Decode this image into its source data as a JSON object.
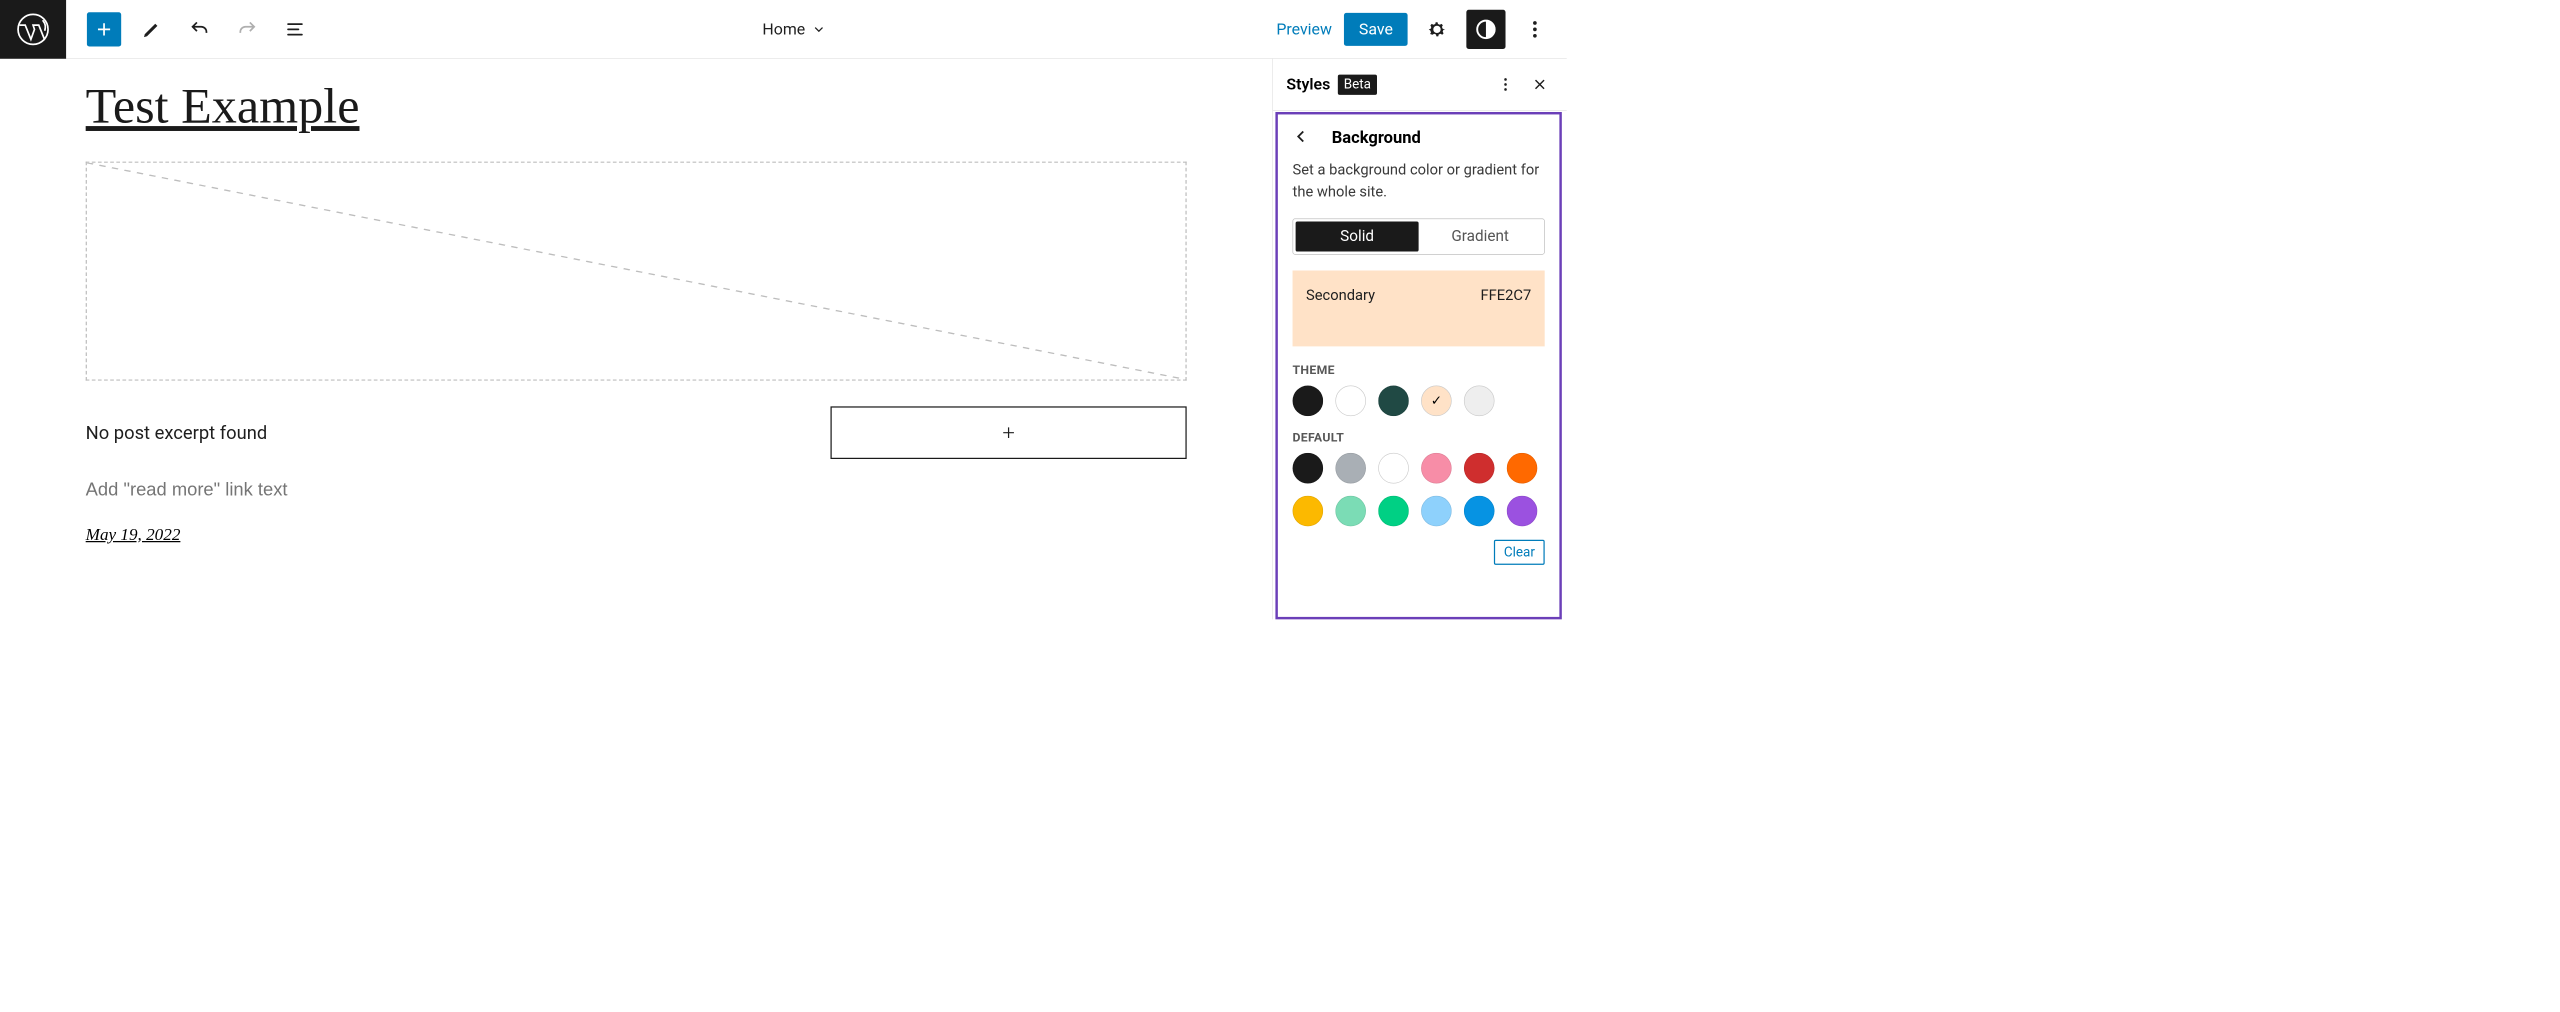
{
  "toolbar": {
    "document_label": "Home",
    "preview_label": "Preview",
    "save_label": "Save"
  },
  "canvas": {
    "site_title": "Test Example",
    "excerpt_text": "No post excerpt found",
    "readmore_placeholder": "Add \"read more\" link text",
    "post_date": "May 19, 2022"
  },
  "sidebar": {
    "title": "Styles",
    "badge": "Beta",
    "panel": {
      "title": "Background",
      "description": "Set a background color or gradient for the whole site.",
      "tabs": {
        "solid": "Solid",
        "gradient": "Gradient",
        "active": "solid"
      },
      "current": {
        "name": "Secondary",
        "hex": "FFE2C7",
        "swatch": "#FFE2C7"
      },
      "groups": [
        {
          "label": "THEME",
          "swatches": [
            {
              "name": "black",
              "hex": "#1a1a1a",
              "light": false,
              "selected": false
            },
            {
              "name": "white",
              "hex": "#ffffff",
              "light": true,
              "selected": false
            },
            {
              "name": "teal-dark",
              "hex": "#204944",
              "light": false,
              "selected": false
            },
            {
              "name": "secondary",
              "hex": "#ffe2c7",
              "light": true,
              "selected": true
            },
            {
              "name": "grey-200",
              "hex": "#eeeeee",
              "light": true,
              "selected": false
            }
          ]
        },
        {
          "label": "DEFAULT",
          "swatches": [
            {
              "name": "black",
              "hex": "#1a1a1a",
              "light": false,
              "selected": false
            },
            {
              "name": "grey",
              "hex": "#a9afb5",
              "light": false,
              "selected": false
            },
            {
              "name": "white",
              "hex": "#ffffff",
              "light": true,
              "selected": false
            },
            {
              "name": "pink",
              "hex": "#f78da7",
              "light": false,
              "selected": false
            },
            {
              "name": "red",
              "hex": "#cf2e2e",
              "light": false,
              "selected": false
            },
            {
              "name": "orange",
              "hex": "#ff6900",
              "light": false,
              "selected": false
            },
            {
              "name": "amber",
              "hex": "#fcb900",
              "light": false,
              "selected": false
            },
            {
              "name": "green-light",
              "hex": "#7bdcb5",
              "light": false,
              "selected": false
            },
            {
              "name": "green",
              "hex": "#00d084",
              "light": false,
              "selected": false
            },
            {
              "name": "blue-light",
              "hex": "#8ed1fc",
              "light": false,
              "selected": false
            },
            {
              "name": "blue",
              "hex": "#0693e3",
              "light": false,
              "selected": false
            },
            {
              "name": "purple",
              "hex": "#9b51e0",
              "light": false,
              "selected": false
            }
          ]
        }
      ],
      "clear_label": "Clear"
    }
  }
}
